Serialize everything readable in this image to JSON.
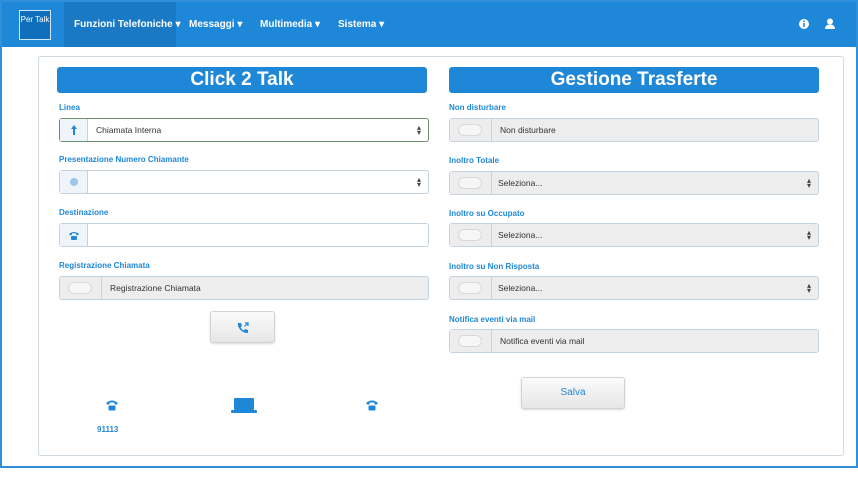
{
  "nav": {
    "logo_text": "Per Talk",
    "items": [
      {
        "label": "Funzioni Telefoniche ▾",
        "active": true
      },
      {
        "label": "Messaggi ▾"
      },
      {
        "label": "Multimedia ▾"
      },
      {
        "label": "Sistema ▾"
      }
    ],
    "right_icons": [
      "info-icon",
      "user-icon"
    ]
  },
  "click2talk": {
    "title": "Click 2 Talk",
    "linea_label": "Linea",
    "linea_value": "Chiamata Interna",
    "presentazione_label": "Presentazione Numero Chiamante",
    "presentazione_value": "",
    "destinazione_label": "Destinazione",
    "destinazione_value": "",
    "registrazione_label": "Registrazione Chiamata",
    "registrazione_text": "Registrazione Chiamata",
    "call_button_icon": "phone-call-icon",
    "extension_number": "91113"
  },
  "trasferte": {
    "title": "Gestione Trasferte",
    "dnd_label": "Non disturbare",
    "dnd_text": "Non disturbare",
    "totale_label": "Inoltro Totale",
    "totale_value": "Seleziona...",
    "occupato_label": "Inoltro su Occupato",
    "occupato_value": "Seleziona...",
    "nonrisposta_label": "Inoltro su Non Risposta",
    "nonrisposta_value": "Seleziona...",
    "notifica_label": "Notifica eventi via mail",
    "notifica_text": "Notifica eventi via mail",
    "save_label": "Salva"
  },
  "colors": {
    "primary": "#1f87d8",
    "field_grey": "#ededed"
  }
}
